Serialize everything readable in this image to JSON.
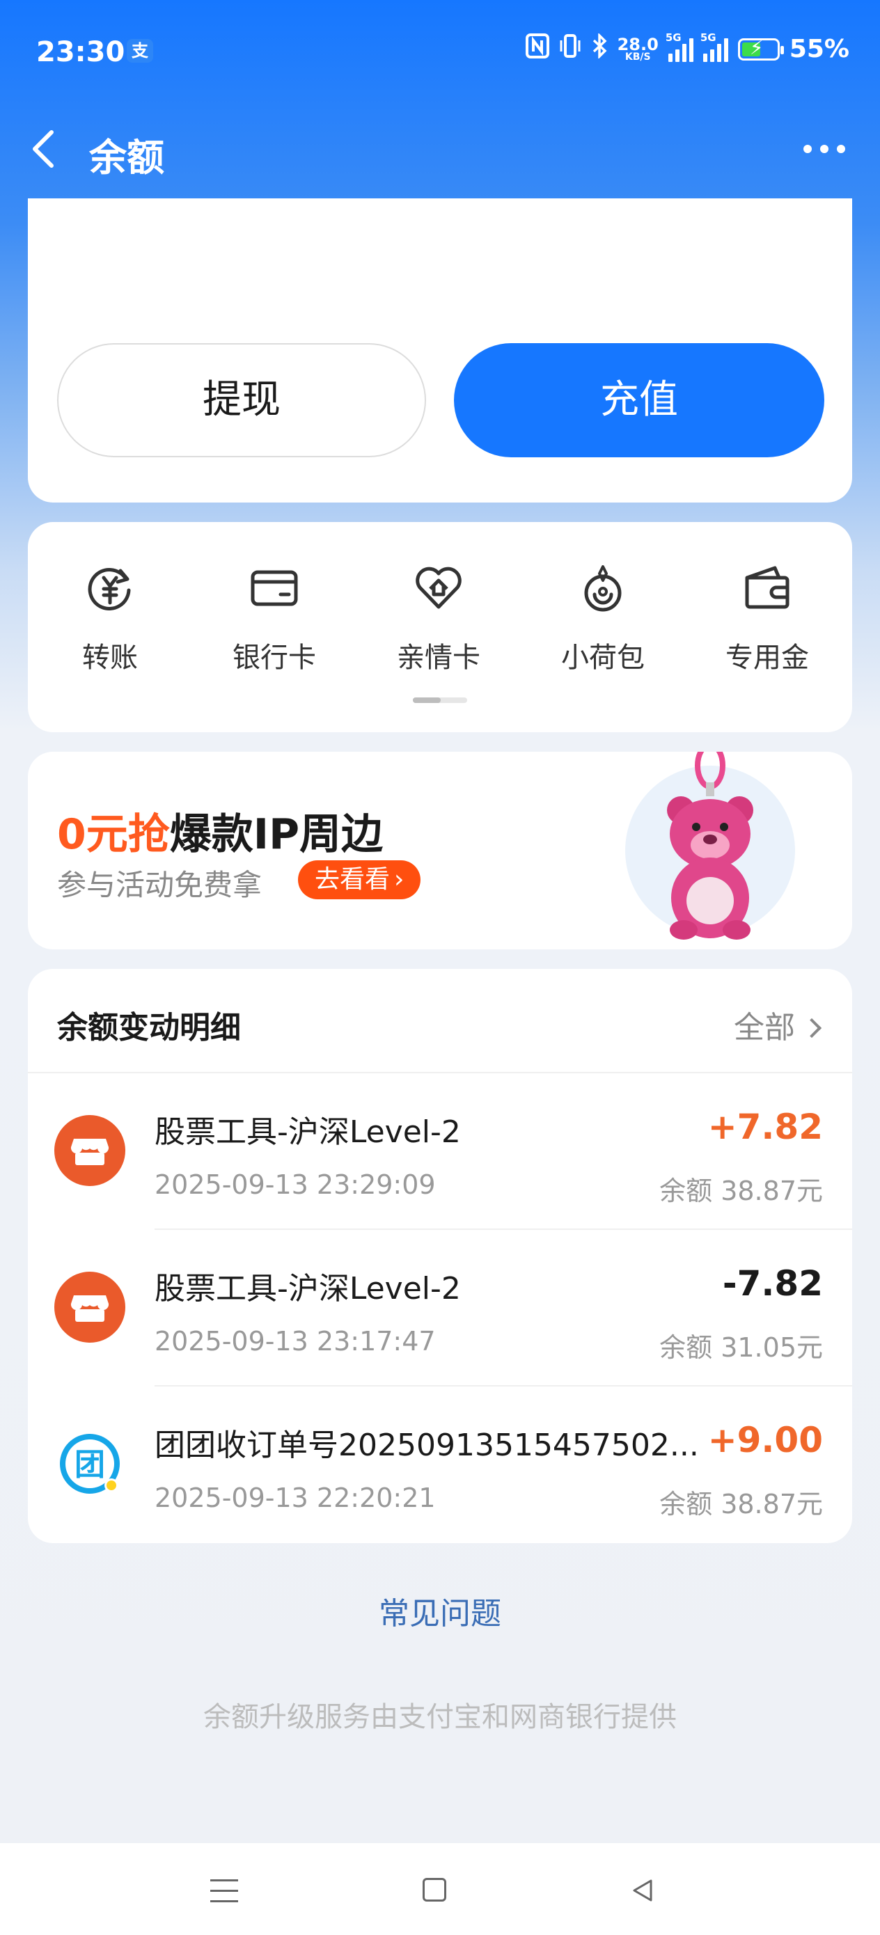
{
  "status_bar": {
    "time": "23:30",
    "app_badge": "支",
    "net_speed_value": "28.0",
    "net_speed_unit": "KB/S",
    "signal1_tag": "5G",
    "signal2_tag": "5G",
    "battery_percent": "55%",
    "battery_level": 0.55,
    "icons": [
      "nfc-icon",
      "vibrate-icon",
      "bluetooth-icon",
      "signal-icon",
      "battery-charging-icon"
    ]
  },
  "nav": {
    "title": "余额"
  },
  "balance_card": {
    "withdraw_label": "提现",
    "recharge_label": "充值"
  },
  "actions": [
    {
      "label": "转账",
      "icon": "transfer-icon"
    },
    {
      "label": "银行卡",
      "icon": "bank-card-icon"
    },
    {
      "label": "亲情卡",
      "icon": "family-card-icon"
    },
    {
      "label": "小荷包",
      "icon": "small-purse-icon"
    },
    {
      "label": "专用金",
      "icon": "dedicated-fund-icon"
    }
  ],
  "promo": {
    "title_highlight": "0元抢",
    "title_rest": "爆款IP周边",
    "subtitle": "参与活动免费拿",
    "button_label": "去看看"
  },
  "ledger": {
    "title": "余额变动明细",
    "all_label": "全部",
    "transactions": [
      {
        "name": "股票工具-沪深Level-2",
        "time": "2025-09-13 23:29:09",
        "amount": "+7.82",
        "balance": "余额 38.87元",
        "icon": "store-icon"
      },
      {
        "name": "股票工具-沪深Level-2",
        "time": "2025-09-13 23:17:47",
        "amount": "-7.82",
        "balance": "余额 31.05元",
        "icon": "store-icon"
      },
      {
        "name": "团团收订单号20250913515457502...",
        "time": "2025-09-13 22:20:21",
        "amount": "+9.00",
        "balance": "余额 38.87元",
        "icon": "tuantuan-icon"
      }
    ]
  },
  "faq_label": "常见问题",
  "footer_note": "余额升级服务由支付宝和网商银行提供",
  "colors": {
    "brand_blue": "#1677ff",
    "positive_amount": "#f0672a",
    "promo_orange": "#ff4f0f"
  }
}
